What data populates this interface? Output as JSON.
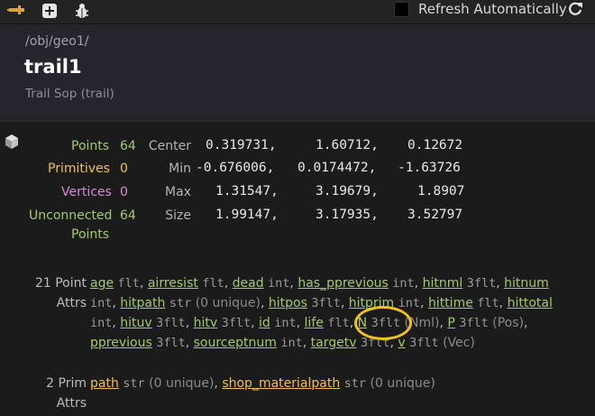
{
  "toolbar": {
    "pin_icon": "pin-icon",
    "add_icon": "add-icon",
    "bug_icon": "bug-icon",
    "refresh_label": "Refresh Automatically",
    "refresh_checked": false,
    "refresh_icon": "refresh-icon"
  },
  "header": {
    "path": "/obj/geo1/",
    "name": "trail1",
    "type": "Trail Sop (trail)"
  },
  "stats": {
    "points": {
      "label": "Points",
      "count": "64",
      "color": "#a4c96b"
    },
    "primitives": {
      "label": "Primitives",
      "count": "0",
      "color": "#f0c056"
    },
    "vertices": {
      "label": "Vertices",
      "count": "0",
      "color": "#d98bd9"
    },
    "unconnected": {
      "label1": "Unconnected",
      "label2": "Points",
      "count": "64",
      "color": "#a4c96b"
    }
  },
  "geometry": {
    "center": {
      "label": "Center",
      "x": "0.319731,",
      "y": "1.60712,",
      "z": "0.12672"
    },
    "min": {
      "label": "Min",
      "x": "-0.676006,",
      "y": "0.0174472,",
      "z": "-1.63726"
    },
    "max": {
      "label": "Max",
      "x": "1.31547,",
      "y": "3.19679,",
      "z": "1.8907"
    },
    "size": {
      "label": "Size",
      "x": "1.99147,",
      "y": "3.17935,",
      "z": "3.52797"
    }
  },
  "point_attrs": {
    "label1": "21 Point",
    "label2": "Attrs",
    "items": [
      {
        "name": "age",
        "type": "flt",
        "note": ""
      },
      {
        "name": "airresist",
        "type": "flt",
        "note": ""
      },
      {
        "name": "dead",
        "type": "int",
        "note": ""
      },
      {
        "name": "has_pprevious",
        "type": "int",
        "note": ""
      },
      {
        "name": "hitnml",
        "type": "3flt",
        "note": ""
      },
      {
        "name": "hitnum",
        "type": "int",
        "note": ""
      },
      {
        "name": "hitpath",
        "type": "str",
        "note": "(0 unique)"
      },
      {
        "name": "hitpos",
        "type": "3flt",
        "note": ""
      },
      {
        "name": "hitprim",
        "type": "int",
        "note": ""
      },
      {
        "name": "hittime",
        "type": "flt",
        "note": ""
      },
      {
        "name": "hittotal",
        "type": "int",
        "note": ""
      },
      {
        "name": "hituv",
        "type": "3flt",
        "note": ""
      },
      {
        "name": "hitv",
        "type": "3flt",
        "note": ""
      },
      {
        "name": "id",
        "type": "int",
        "note": ""
      },
      {
        "name": "life",
        "type": "flt",
        "note": ""
      },
      {
        "name": "N",
        "type": "3flt",
        "note": "(Nml)"
      },
      {
        "name": "P",
        "type": "3flt",
        "note": "(Pos)"
      },
      {
        "name": "pprevious",
        "type": "3flt",
        "note": ""
      },
      {
        "name": "sourceptnum",
        "type": "int",
        "note": ""
      },
      {
        "name": "targetv",
        "type": "3flt",
        "note": ""
      },
      {
        "name": "v",
        "type": "3flt",
        "note": "(Vec)"
      }
    ]
  },
  "prim_attrs": {
    "label1": "2 Prim",
    "label2": "Attrs",
    "items": [
      {
        "name": "path",
        "type": "str",
        "note": "(0 unique)"
      },
      {
        "name": "shop_materialpath",
        "type": "str",
        "note": "(0 unique)"
      }
    ]
  },
  "highlight": {
    "target": "id",
    "color": "#f2c21c"
  }
}
